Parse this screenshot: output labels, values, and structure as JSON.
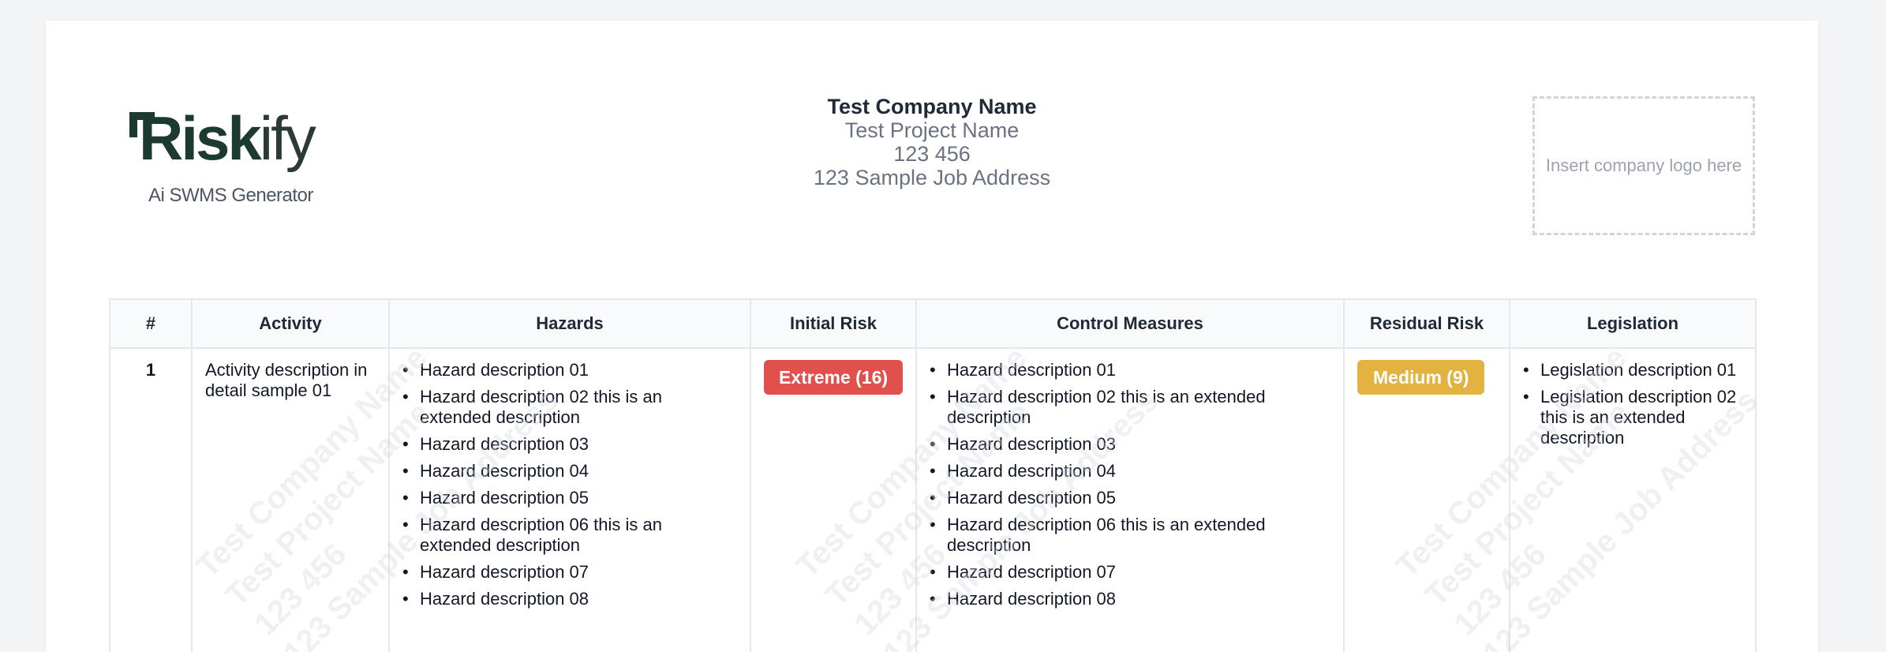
{
  "branding": {
    "logo_main_bold": "Risk",
    "logo_main_light": "ify",
    "logo_sub": "Ai SWMS Generator"
  },
  "company": {
    "name": "Test Company Name",
    "project": "Test Project Name",
    "number": "123 456",
    "address": "123 Sample Job Address",
    "logo_placeholder": "Insert company logo here"
  },
  "table": {
    "headers": [
      "#",
      "Activity",
      "Hazards",
      "Initial Risk",
      "Control Measures",
      "Residual Risk",
      "Legislation"
    ],
    "rows": [
      {
        "num": "1",
        "activity": "Activity description in detail sample 01",
        "hazards": [
          "Hazard description 01",
          "Hazard description 02 this is an extended description",
          "Hazard description 03",
          "Hazard description 04",
          "Hazard description 05",
          "Hazard description 06 this is an extended description",
          "Hazard description 07",
          "Hazard description 08"
        ],
        "initial_risk": "Extreme (16)",
        "initial_risk_color": "#e0504d",
        "controls": [
          "Hazard description 01",
          "Hazard description 02 this is an extended description",
          "Hazard description 03",
          "Hazard description 04",
          "Hazard description 05",
          "Hazard description 06 this is an extended description",
          "Hazard description 07",
          "Hazard description 08"
        ],
        "residual_risk": "Medium (9)",
        "residual_risk_color": "#e3b341",
        "legislation": [
          "Legislation description 01",
          "Legislation description 02 this is an extended description"
        ]
      }
    ]
  },
  "watermark": [
    "Test Company Name",
    "Test Project Name",
    "123 456",
    "123 Sample Job Address"
  ]
}
